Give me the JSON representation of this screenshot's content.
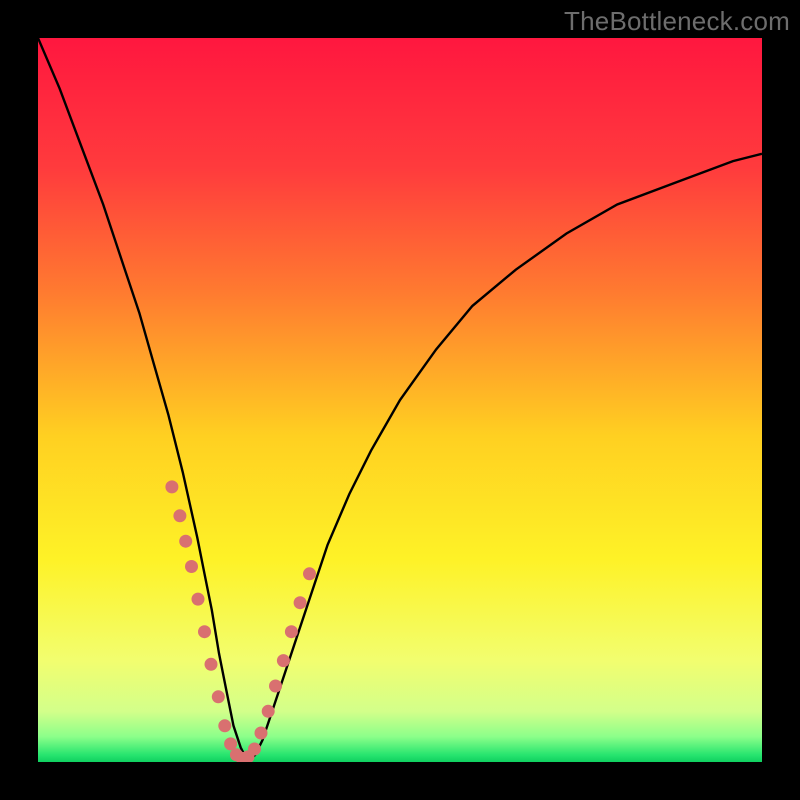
{
  "watermark": "TheBottleneck.com",
  "chart_data": {
    "type": "line",
    "title": "",
    "xlabel": "",
    "ylabel": "",
    "xlim": [
      0,
      100
    ],
    "ylim": [
      0,
      100
    ],
    "background": {
      "type": "vertical-gradient",
      "stops": [
        {
          "pos": 0.0,
          "color": "#ff173f"
        },
        {
          "pos": 0.18,
          "color": "#ff3b3d"
        },
        {
          "pos": 0.35,
          "color": "#ff7a30"
        },
        {
          "pos": 0.55,
          "color": "#ffd021"
        },
        {
          "pos": 0.72,
          "color": "#fef227"
        },
        {
          "pos": 0.86,
          "color": "#f2fe6f"
        },
        {
          "pos": 0.93,
          "color": "#d3ff8a"
        },
        {
          "pos": 0.965,
          "color": "#8cff8a"
        },
        {
          "pos": 0.99,
          "color": "#28e56f"
        },
        {
          "pos": 1.0,
          "color": "#0fd060"
        }
      ]
    },
    "series": [
      {
        "name": "bottleneck-curve",
        "color": "#000000",
        "x": [
          0,
          3,
          6,
          9,
          12,
          14,
          16,
          18,
          20,
          22,
          23,
          24,
          25,
          26,
          27,
          28,
          29,
          30,
          31,
          32,
          34,
          36,
          38,
          40,
          43,
          46,
          50,
          55,
          60,
          66,
          73,
          80,
          88,
          96,
          100
        ],
        "y": [
          100,
          93,
          85,
          77,
          68,
          62,
          55,
          48,
          40,
          31,
          26,
          21,
          15,
          10,
          5,
          2,
          0,
          1,
          3,
          6,
          12,
          18,
          24,
          30,
          37,
          43,
          50,
          57,
          63,
          68,
          73,
          77,
          80,
          83,
          84
        ]
      }
    ],
    "markers": {
      "name": "highlight-dots",
      "color": "#d97070",
      "radius_pct": 0.9,
      "x": [
        18.5,
        19.6,
        20.4,
        21.2,
        22.1,
        23.0,
        23.9,
        24.9,
        25.8,
        26.6,
        27.4,
        28.2,
        29.0,
        29.9,
        30.8,
        31.8,
        32.8,
        33.9,
        35.0,
        36.2,
        37.5
      ],
      "y": [
        38.0,
        34.0,
        30.5,
        27.0,
        22.5,
        18.0,
        13.5,
        9.0,
        5.0,
        2.5,
        1.0,
        0.5,
        0.7,
        1.8,
        4.0,
        7.0,
        10.5,
        14.0,
        18.0,
        22.0,
        26.0
      ]
    }
  }
}
